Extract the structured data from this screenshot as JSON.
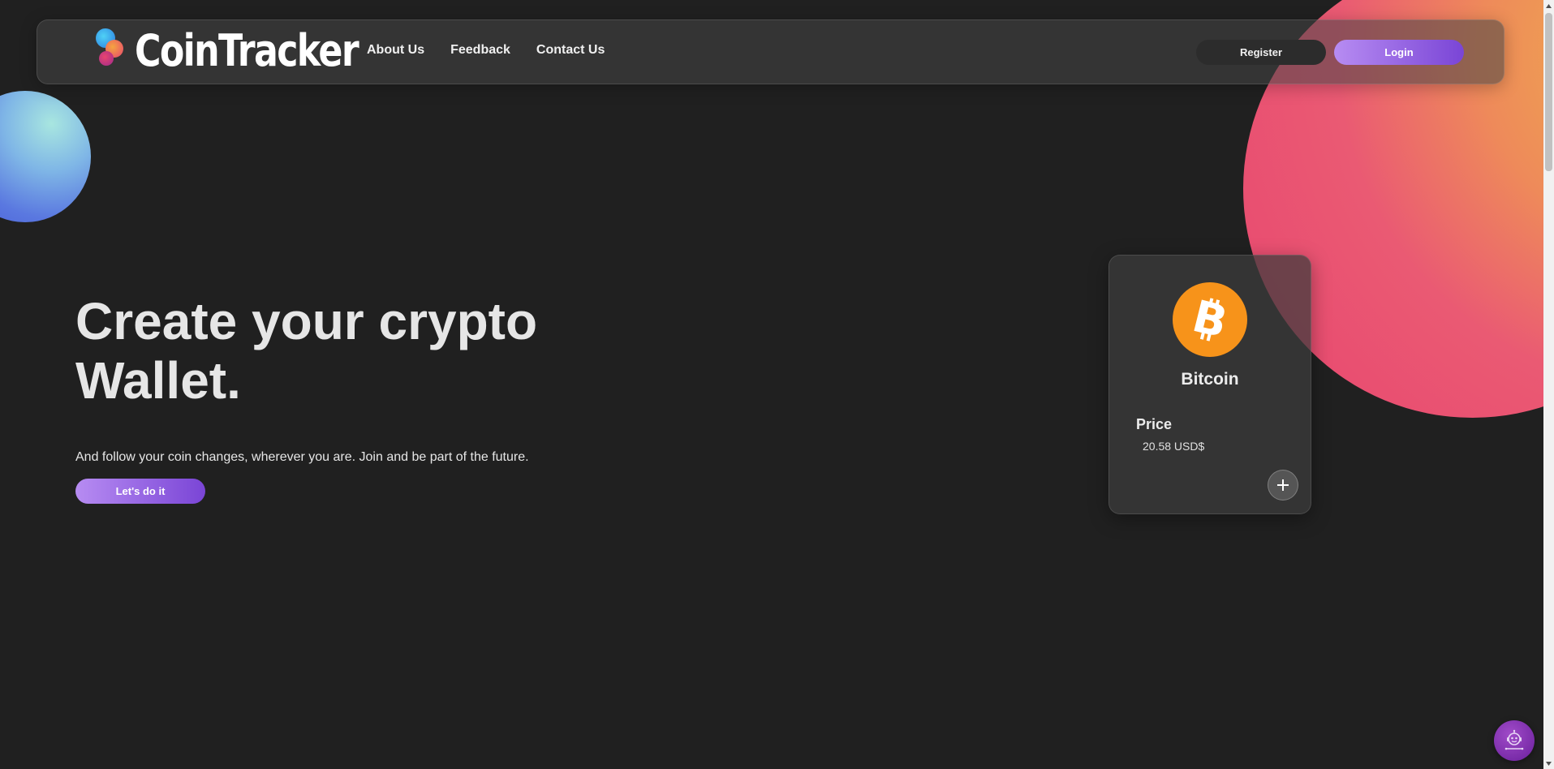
{
  "colors": {
    "background": "#202020",
    "accent_gradient_start": "#b78cf2",
    "accent_gradient_end": "#7a45d6",
    "bitcoin_orange": "#f7931a"
  },
  "header": {
    "logo_text": "CoinTracker",
    "nav": [
      {
        "label": "About Us"
      },
      {
        "label": "Feedback"
      },
      {
        "label": "Contact Us"
      }
    ],
    "register_label": "Register",
    "login_label": "Login"
  },
  "hero": {
    "title_line1": "Create your crypto",
    "title_line2": "Wallet.",
    "subtitle": "And follow your coin changes, wherever you are. Join and be part of the future.",
    "cta_label": "Let's do it"
  },
  "coin_card": {
    "icon": "bitcoin-icon",
    "name": "Bitcoin",
    "price_label": "Price",
    "price_value": "20.58 USD$",
    "add_icon": "plus-icon"
  },
  "assistant": {
    "icon": "robot-icon"
  }
}
